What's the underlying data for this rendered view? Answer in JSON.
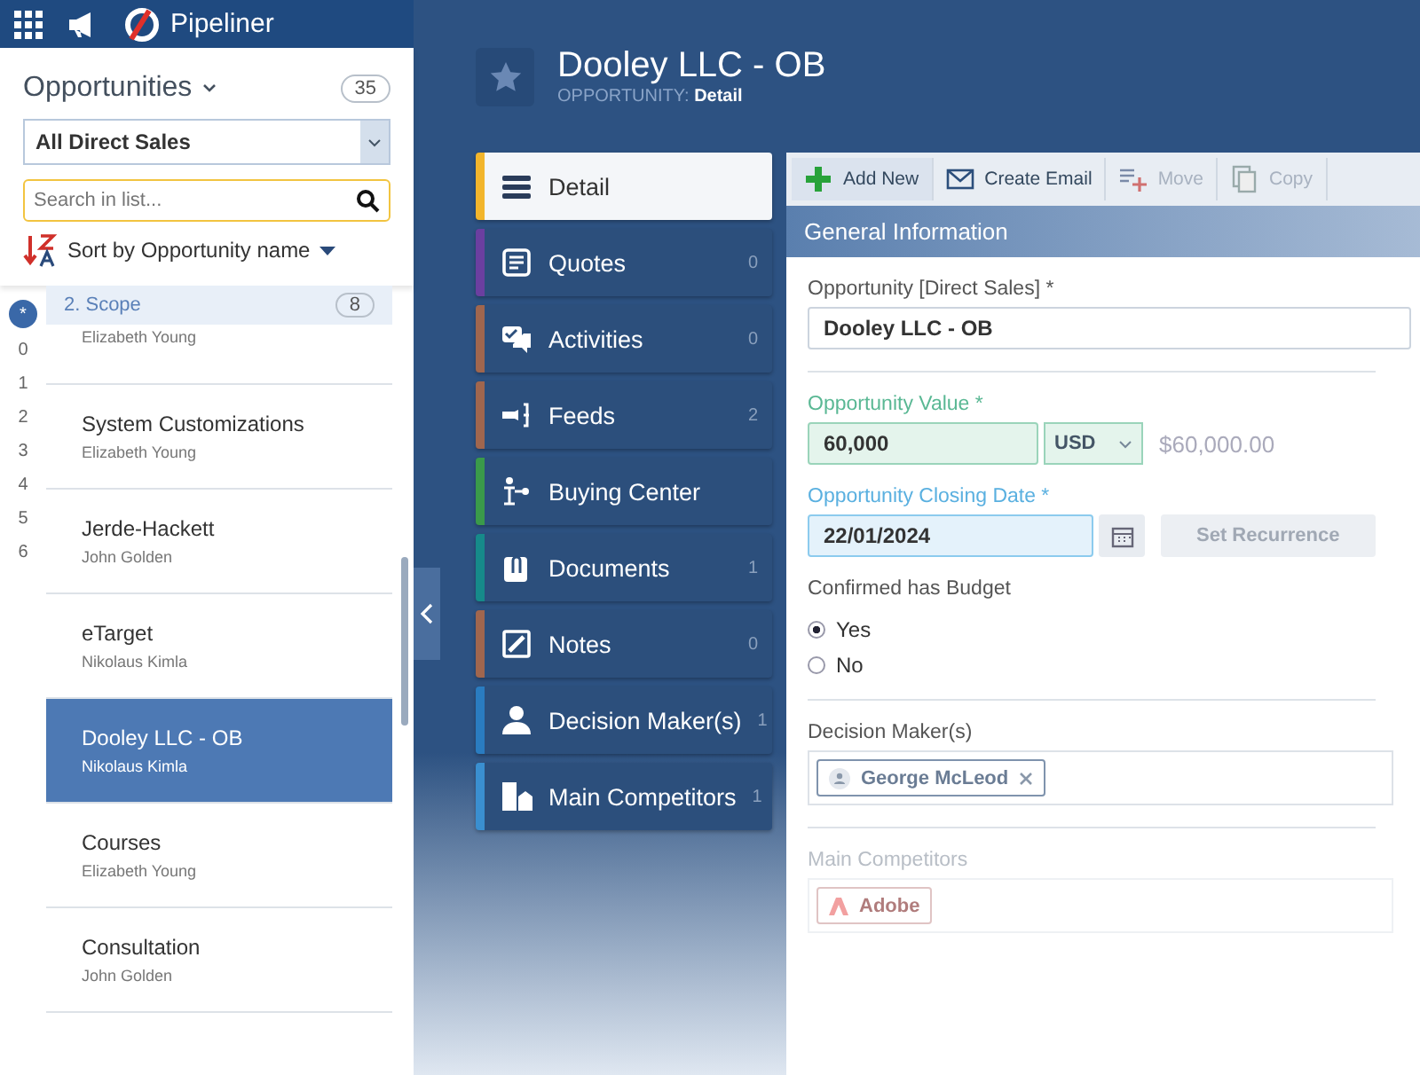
{
  "topbar": {
    "app_name": "Pipeliner"
  },
  "list_panel": {
    "title": "Opportunities",
    "count": "35",
    "view": "All Direct Sales",
    "search": {
      "placeholder": "Search in list..."
    },
    "sort": "Sort by Opportunity name",
    "index": [
      {
        "label": "*",
        "selected": true
      },
      {
        "label": "0",
        "selected": false
      },
      {
        "label": "1",
        "selected": false
      },
      {
        "label": "2",
        "selected": false
      },
      {
        "label": "3",
        "selected": false
      },
      {
        "label": "4",
        "selected": false
      },
      {
        "label": "5",
        "selected": false
      },
      {
        "label": "6",
        "selected": false
      }
    ],
    "group": {
      "label": "2. Scope",
      "count": "8"
    },
    "items": [
      {
        "owner": "Elizabeth Young",
        "selected": false
      },
      {
        "name": "System Customizations",
        "owner": "Elizabeth Young",
        "selected": false
      },
      {
        "name": "Jerde-Hackett",
        "owner": "John Golden",
        "selected": false
      },
      {
        "name": "eTarget",
        "owner": "Nikolaus Kimla",
        "selected": false
      },
      {
        "name": "Dooley LLC - OB",
        "owner": "Nikolaus Kimla",
        "selected": true
      },
      {
        "name": "Courses",
        "owner": "Elizabeth Young",
        "selected": false
      },
      {
        "name": "Consultation",
        "owner": "John Golden",
        "selected": false
      }
    ]
  },
  "record": {
    "title": "Dooley LLC - OB",
    "type_label": "OPPORTUNITY:",
    "view": "Detail"
  },
  "nav": [
    {
      "kind": "detail",
      "label": "Detail",
      "color": "#f2b52c",
      "selected": true
    },
    {
      "kind": "quotes",
      "label": "Quotes",
      "count": "0",
      "color": "#6b3fa0",
      "selected": false
    },
    {
      "kind": "activities",
      "label": "Activities",
      "count": "0",
      "color": "#a0664e",
      "selected": false
    },
    {
      "kind": "feeds",
      "label": "Feeds",
      "count": "2",
      "color": "#a0664e",
      "selected": false
    },
    {
      "kind": "buying",
      "label": "Buying Center",
      "color": "#3a9a4a",
      "selected": false
    },
    {
      "kind": "documents",
      "label": "Documents",
      "count": "1",
      "color": "#168a8a",
      "selected": false
    },
    {
      "kind": "notes",
      "label": "Notes",
      "count": "0",
      "color": "#a0664e",
      "selected": false
    },
    {
      "kind": "person",
      "label": "Decision Maker(s)",
      "count": "1",
      "color": "#2a7cc0",
      "selected": false
    },
    {
      "kind": "building",
      "label": "Main Competitors",
      "count": "1",
      "color": "#3a8fd0",
      "selected": false
    }
  ],
  "toolbar": [
    {
      "kind": "add",
      "label": "Add New",
      "disabled": false
    },
    {
      "kind": "email",
      "label": "Create Email",
      "disabled": false
    },
    {
      "kind": "move",
      "label": "Move",
      "disabled": true
    },
    {
      "kind": "copy",
      "label": "Copy",
      "disabled": true
    }
  ],
  "form": {
    "section": "General Information",
    "name_field": {
      "label": "Opportunity [Direct Sales] *",
      "value": "Dooley LLC - OB"
    },
    "value_field": {
      "label": "Opportunity Value *",
      "value": "60,000",
      "currency": "USD",
      "formatted": "$60,000.00"
    },
    "date_field": {
      "label": "Opportunity Closing Date *",
      "value": "22/01/2024",
      "recurrence": "Set Recurrence"
    },
    "budget": {
      "label": "Confirmed has Budget",
      "options": [
        {
          "label": "Yes",
          "selected": true
        },
        {
          "label": "No",
          "selected": false
        }
      ]
    },
    "decision_makers": {
      "label": "Decision Maker(s)",
      "chips": [
        "George McLeod"
      ]
    },
    "competitors": {
      "label": "Main Competitors",
      "chips": [
        "Adobe"
      ]
    }
  }
}
